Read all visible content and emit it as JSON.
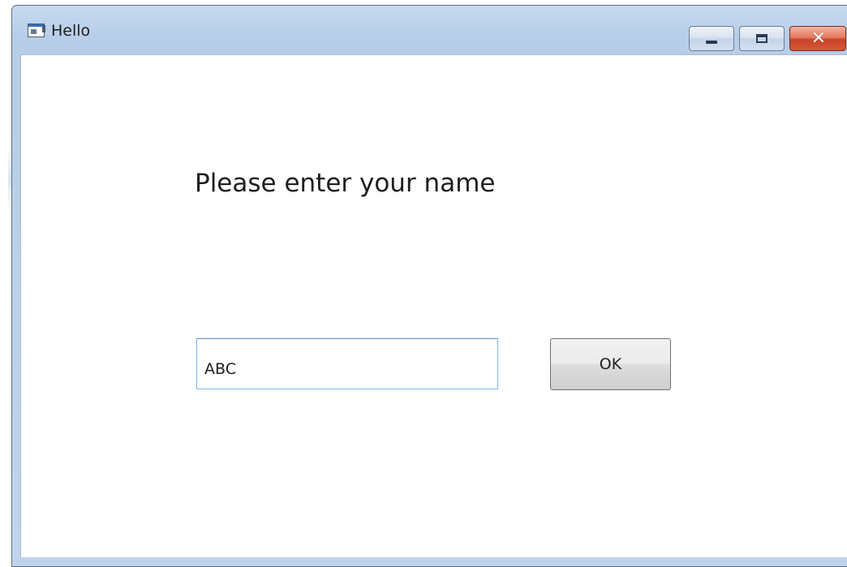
{
  "window": {
    "title": "Hello",
    "icon": "window-app-icon",
    "controls": {
      "minimize_icon": "minimize-icon",
      "maximize_icon": "maximize-icon",
      "close_icon": "close-icon",
      "close_glyph": "✕"
    }
  },
  "form": {
    "prompt": "Please enter your name",
    "name_value": "ABC",
    "ok_label": "OK"
  },
  "colors": {
    "titlebar": "#b7cde8",
    "close_button": "#c8432a",
    "input_border": "#7eb4ea"
  }
}
